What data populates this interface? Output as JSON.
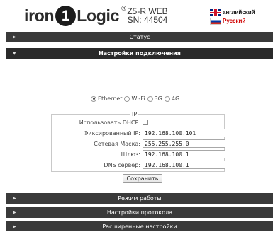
{
  "header": {
    "logo": {
      "iron": "iron",
      "one": "1",
      "logic": "Logic",
      "reg": "®"
    },
    "device_model": "Z5-R WEB",
    "serial": "SN: 44504",
    "languages": [
      {
        "label": "английский",
        "flag": "uk-flag-icon"
      },
      {
        "label": "Русский",
        "flag": "ru-flag-icon"
      }
    ]
  },
  "sections": [
    {
      "title": "Статус",
      "expanded": false
    },
    {
      "title": "Настройки подключения",
      "expanded": true
    },
    {
      "title": "Режим работы",
      "expanded": false
    },
    {
      "title": "Настройки протокола",
      "expanded": false
    },
    {
      "title": "Расширенные настройки",
      "expanded": false
    }
  ],
  "connection": {
    "types": [
      "Ethernet",
      "Wi-Fi",
      "3G",
      "4G"
    ],
    "selected": "Ethernet",
    "ip_legend": "IP",
    "dhcp_label": "Использовать DHCP:",
    "dhcp_checked": false,
    "fields": [
      {
        "label": "Фиксированный IP:",
        "value": "192.168.100.101"
      },
      {
        "label": "Сетевая Маска:",
        "value": "255.255.255.0"
      },
      {
        "label": "Шлюз:",
        "value": "192.168.100.1"
      },
      {
        "label": "DNS сервер:",
        "value": "192.168.100.1"
      }
    ],
    "save_label": "Сохранить"
  },
  "colors": {
    "bar_background": "#3a3a3a",
    "bar_text": "#ffffff",
    "lang_ru_text": "#d00000"
  }
}
